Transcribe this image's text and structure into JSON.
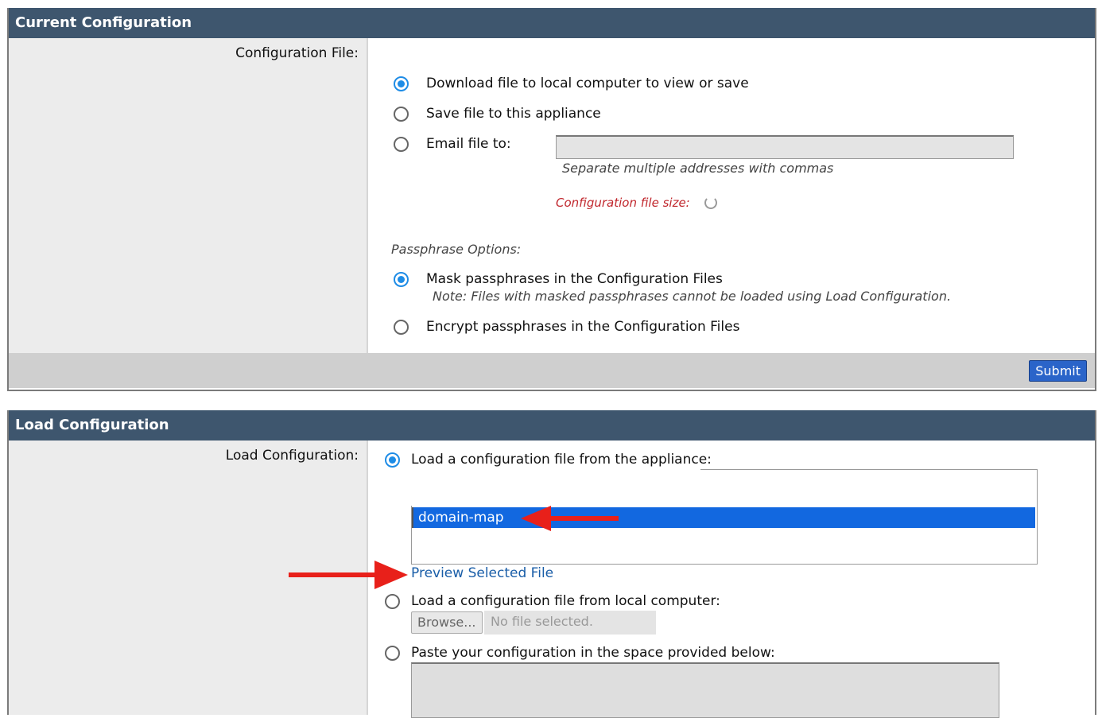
{
  "current_config": {
    "header": "Current Configuration",
    "field_label": "Configuration File:",
    "opt_download": "Download file to local computer to view or save",
    "opt_save": "Save file to this appliance",
    "opt_email": "Email file to:",
    "email_value": "",
    "email_hint": "Separate multiple addresses with commas",
    "file_size_label": "Configuration file size:",
    "passphrase_heading": "Passphrase Options:",
    "opt_mask": "Mask passphrases in the Configuration Files",
    "mask_note": "Note: Files with masked passphrases cannot be loaded using Load Configuration.",
    "opt_encrypt": "Encrypt passphrases in the Configuration Files",
    "submit_label": "Submit"
  },
  "load_config": {
    "header": "Load Configuration",
    "field_label": "Load Configuration:",
    "opt_appliance": "Load a configuration file from the appliance:",
    "files": [
      "domain-map"
    ],
    "preview_link": "Preview Selected File",
    "opt_local": "Load a configuration file from local computer:",
    "browse_label": "Browse...",
    "no_file": "No file selected.",
    "opt_paste": "Paste your configuration in the space provided below:"
  },
  "colors": {
    "header_bg": "#3e566e",
    "accent_blue": "#1e8ce6",
    "selection_blue": "#1268e0",
    "annotation_red": "#e8201a",
    "size_label_red": "#c0262c"
  }
}
